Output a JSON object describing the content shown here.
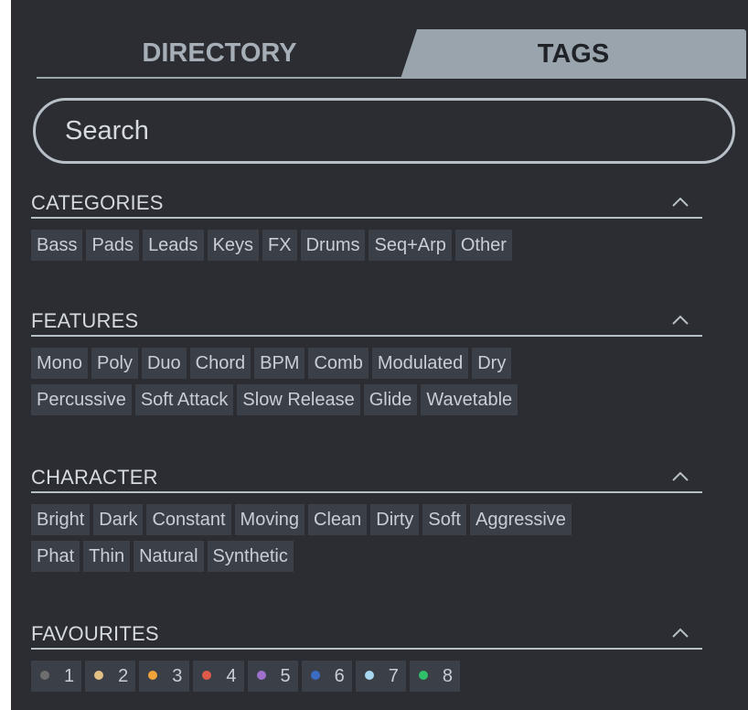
{
  "tabs": {
    "directory": "DIRECTORY",
    "tags": "TAGS"
  },
  "search": {
    "placeholder": "Search"
  },
  "sections": {
    "categories": {
      "title": "CATEGORIES",
      "rows": [
        [
          "Bass",
          "Pads",
          "Leads",
          "Keys",
          "FX",
          "Drums",
          "Seq+Arp",
          "Other"
        ]
      ]
    },
    "features": {
      "title": "FEATURES",
      "rows": [
        [
          "Mono",
          "Poly",
          "Duo",
          "Chord",
          "BPM",
          "Comb",
          "Modulated",
          "Dry"
        ],
        [
          "Percussive",
          "Soft Attack",
          "Slow Release",
          "Glide",
          "Wavetable"
        ]
      ]
    },
    "character": {
      "title": "CHARACTER",
      "rows": [
        [
          "Bright",
          "Dark",
          "Constant",
          "Moving",
          "Clean",
          "Dirty",
          "Soft",
          "Aggressive"
        ],
        [
          "Phat",
          "Thin",
          "Natural",
          "Synthetic"
        ]
      ]
    },
    "favourites": {
      "title": "FAVOURITES",
      "items": [
        {
          "label": "1",
          "color": "#6e6e6e"
        },
        {
          "label": "2",
          "color": "#e3bf86"
        },
        {
          "label": "3",
          "color": "#f0a33a"
        },
        {
          "label": "4",
          "color": "#e05a4a"
        },
        {
          "label": "5",
          "color": "#a070cf"
        },
        {
          "label": "6",
          "color": "#3a6cc4"
        },
        {
          "label": "7",
          "color": "#a8d8f0"
        },
        {
          "label": "8",
          "color": "#30c06a"
        }
      ]
    }
  },
  "icons": {
    "collapse": "chevron-up-icon"
  }
}
